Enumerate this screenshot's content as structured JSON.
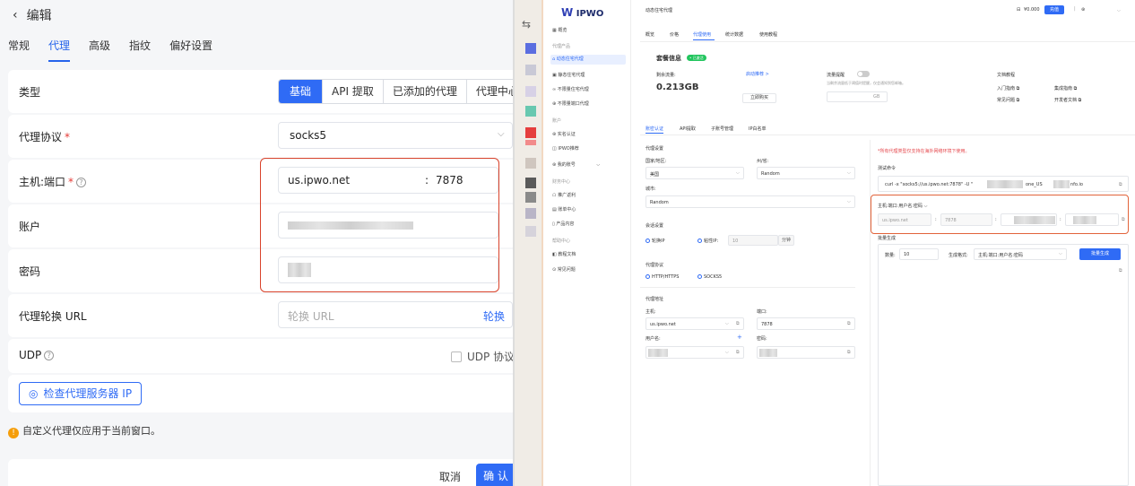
{
  "left": {
    "back_icon": "‹",
    "title": "编辑",
    "tabs": [
      "常规",
      "代理",
      "高级",
      "指纹",
      "偏好设置"
    ],
    "type_label": "类型",
    "type_options": [
      "基础",
      "API 提取",
      "已添加的代理",
      "代理中心"
    ],
    "protocol_label": "代理协议",
    "protocol_value": "socks5",
    "host_label": "主机:端口",
    "host_value": "us.ipwo.net",
    "port_sep": ":",
    "port_value": "7878",
    "account_label": "账户",
    "password_label": "密码",
    "rotate_label": "代理轮换 URL",
    "rotate_placeholder": "轮换 URL",
    "rotate_button": "轮换",
    "udp_label": "UDP",
    "udp_checkbox_label": "UDP 协议",
    "check_button": "检查代理服务器 IP",
    "note": "自定义代理仅应用于当前窗口。",
    "cancel": "取消",
    "confirm": "确 认",
    "required_mark": "*",
    "help_mark": "?"
  },
  "strip": {
    "tick_icon": "⇆"
  },
  "right": {
    "logo": "IPWO",
    "breadcrumb": "动态住宅代理",
    "balance": "¥0.000",
    "recharge": "充值",
    "sidebar": {
      "overview": "概览",
      "sec_products": "代理产品",
      "dynamic": "动态住宅代理",
      "static": "静态住宅代理",
      "unlimited": "不限量住宅代理",
      "unlimited_port": "不限量端口代理",
      "sec_account": "账户",
      "verify": "实名认证",
      "ipwo_sub": "IPWO推荐",
      "my_account": "我的账号",
      "sec_finance": "财务中心",
      "referral": "推广返利",
      "billing": "账单中心",
      "products": "产品内容",
      "sec_help": "帮助中心",
      "docs": "教程文档",
      "faq": "常见问题"
    },
    "top_tabs": [
      "概览",
      "价格",
      "代理使用",
      "统计数据",
      "使用教程"
    ],
    "package_title": "套餐信息",
    "package_badge": "• 已激活",
    "remaining_label": "剩余流量:",
    "remaining_link": "启动推荐 >",
    "remaining_value": "0.213GB",
    "renew_button": "立即购买",
    "traffic_alert_label": "流量提醒",
    "traffic_alert_desc": "当剩余流量低于阈值时提醒，仅会通知到您邮箱。",
    "gb_unit": "GB",
    "docs_title": "文档教程",
    "doc_links": [
      "入门指南 ⧉",
      "集成指南 ⧉",
      "常见问题 ⧉",
      "开发者文档 ⧉"
    ],
    "sub_tabs": [
      "账密认证",
      "API提取",
      "子账号管理",
      "IP白名单"
    ],
    "proxy_settings": "代理设置",
    "region_label": "国家/地区:",
    "region_value": "美国",
    "state_label": "州/省:",
    "state_value": "Random",
    "city_label": "城市:",
    "city_value": "Random",
    "session_settings": "会话设置",
    "session_rotate": "轮换IP",
    "session_sticky": "粘性IP:",
    "session_minutes_value": "10",
    "session_minutes_unit": "分钟",
    "proxy_protocol": "代理协议",
    "proto_http": "HTTP/HTTPS",
    "proto_socks": "SOCKS5",
    "proxy_address": "代理地址",
    "host_label": "主机:",
    "host_value": "us.ipwo.net",
    "port_label": "端口:",
    "port_value": "7878",
    "user_label": "用户名:",
    "plus": "+",
    "pass_label": "密码:",
    "notice": "*所有代理类型仅支持在海外网络环境下使用。",
    "test_cmd_label": "测试命令",
    "test_cmd": "curl -x \"socks5://us.ipwo.net:7878\" -U \"",
    "test_cmd_mid": "one_US",
    "test_cmd_end": "nfo.io",
    "format_label": "主机:端口:用户名:密码",
    "format_host": "us.ipwo.net",
    "format_port": "7878",
    "colon": ":",
    "batch_label": "批量生成",
    "qty_label": "数量:",
    "qty_value": "10",
    "gen_format_label": "生成格式:",
    "gen_format_value": "主机:端口:用户名:密码",
    "gen_button": "批量生成"
  }
}
